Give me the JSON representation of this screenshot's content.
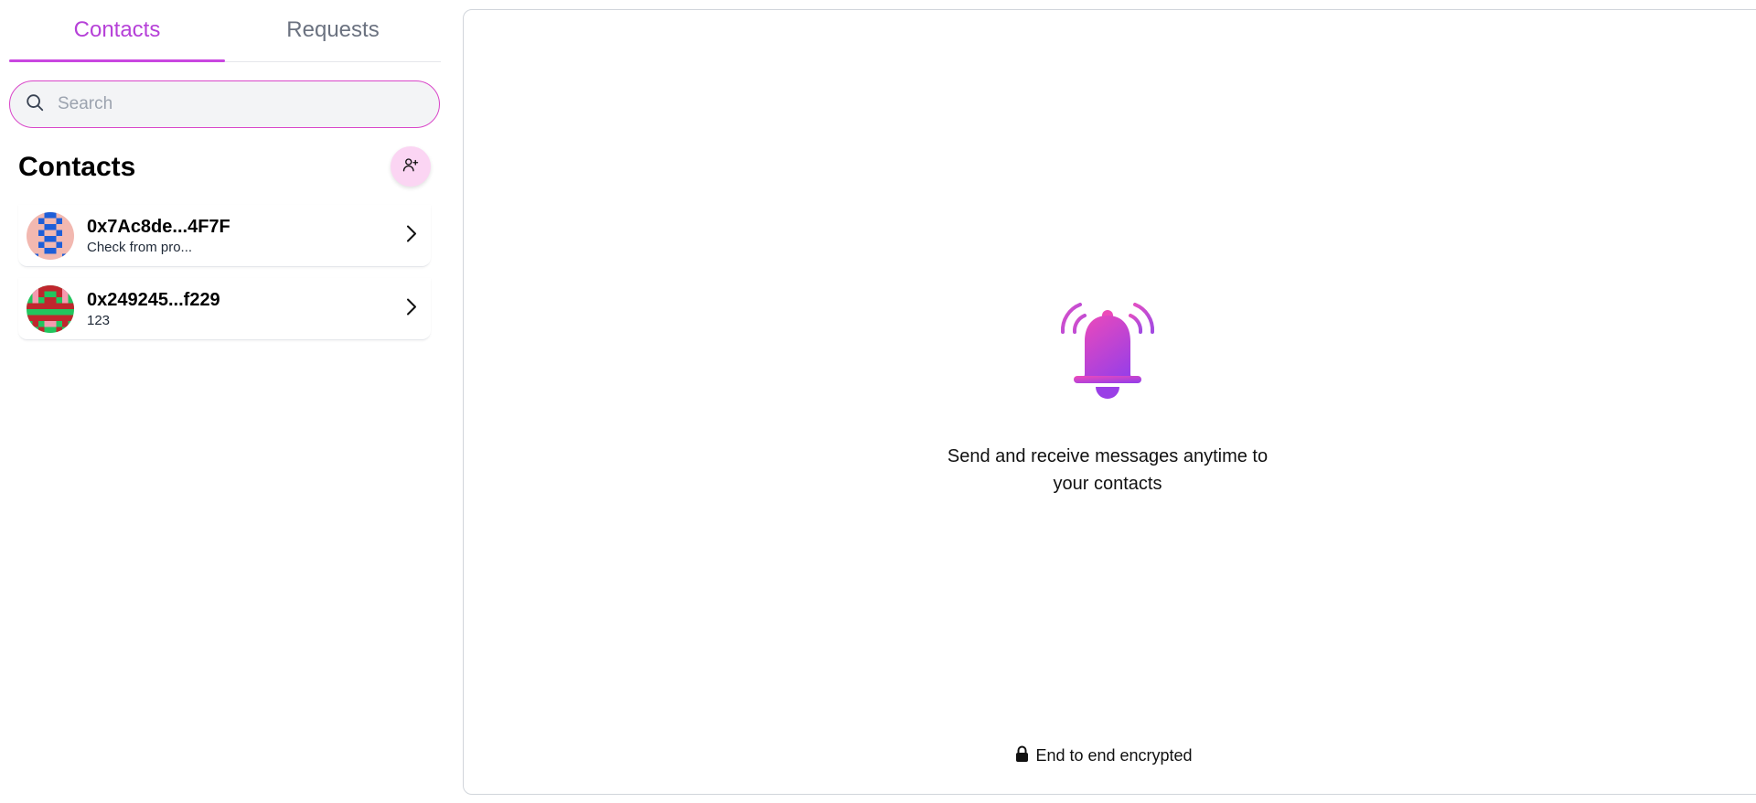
{
  "tabs": [
    {
      "label": "Contacts",
      "active": true
    },
    {
      "label": "Requests",
      "active": false
    }
  ],
  "search": {
    "placeholder": "Search",
    "value": ""
  },
  "contacts_section": {
    "title": "Contacts"
  },
  "contacts": [
    {
      "name": "0x7Ac8de...4F7F",
      "preview": "Check from pro...",
      "avatar_colors": [
        "#f2b8b0",
        "#1e5ed8"
      ]
    },
    {
      "name": "0x249245...f229",
      "preview": "123",
      "avatar_colors": [
        "#22c55e",
        "#c0262d",
        "#f59ab0"
      ]
    }
  ],
  "empty_state": {
    "message": "Send and receive messages anytime to your contacts",
    "icon": "bell-icon"
  },
  "footer": {
    "encryption": "End to end encrypted",
    "icon": "lock-icon"
  },
  "colors": {
    "accent": "#b641d8",
    "accent_border": "#d946c9",
    "add_button_bg": "#fbd5f3"
  }
}
